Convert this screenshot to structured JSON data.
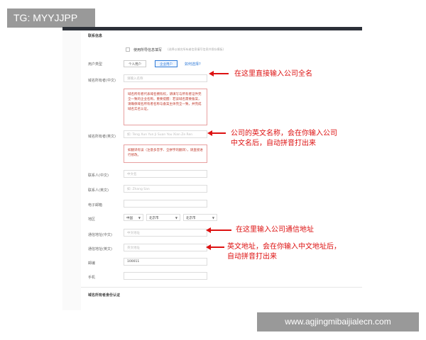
{
  "watermark": {
    "tag": "TG: MYYJJPP",
    "url": "www.agjingmibaijialecn.com"
  },
  "form": {
    "section_top": "联系信息",
    "checkbox_label": "使用所导信息填写",
    "checkbox_hint": "(选择以域名所有者信息填写信息并保存模板)",
    "user_type_label": "用户类型",
    "user_type_options": [
      "个人用户",
      "企业用户"
    ],
    "how_to_choose": "如何选择?",
    "owner_cn_label": "域名所有者(中文)",
    "owner_cn_placeholder": "请输入名称",
    "owner_cn_warning": "域名所有者代表域名拥有权，请填写与所有者证件完全一致的企业名称。重要提醒：若该域名需要备案，请确保域名所有者名称与备案主体完全一致，并完成域名实名认证。",
    "owner_en_label": "域名所有者(英文)",
    "owner_en_placeholder": "如: Teng Xun Yun Ji Suan You Xian Ze Ren",
    "owner_en_warning": "如翻译有误（注意多音字、全拼字的翻译），请直接进行修改。",
    "contact_cn_label": "联系人(中文)",
    "contact_cn_placeholder": "中文名",
    "contact_en_label": "联系人(英文)",
    "contact_en_placeholder": "如: Zhang San",
    "email_label": "电子邮箱",
    "region_label": "地区",
    "region_values": [
      "中国",
      "北京市",
      "北京市"
    ],
    "addr_cn_label": "通信地址(中文)",
    "addr_cn_placeholder": "中文地址",
    "addr_en_label": "通信地址(英文)",
    "addr_en_placeholder": "英文地址",
    "zip_label": "邮编",
    "zip_value": "100011",
    "phone_label": "手机",
    "section_bottom": "域名所有者身份认证"
  },
  "annotations": {
    "a1": "在这里直接输入公司全名",
    "a2_line1": "公司的英文名称，会在你输入公司",
    "a2_line2": "中文名后，自动拼音打出来",
    "a3": "在这里输入公司通信地址",
    "a4_line1": "英文地址，会在你输入中文地址后，",
    "a4_line2": "自动拼音打出来"
  },
  "colors": {
    "annotation": "#dd1111",
    "accent": "#2f7bd8",
    "warning_border": "#e8a0a0"
  }
}
